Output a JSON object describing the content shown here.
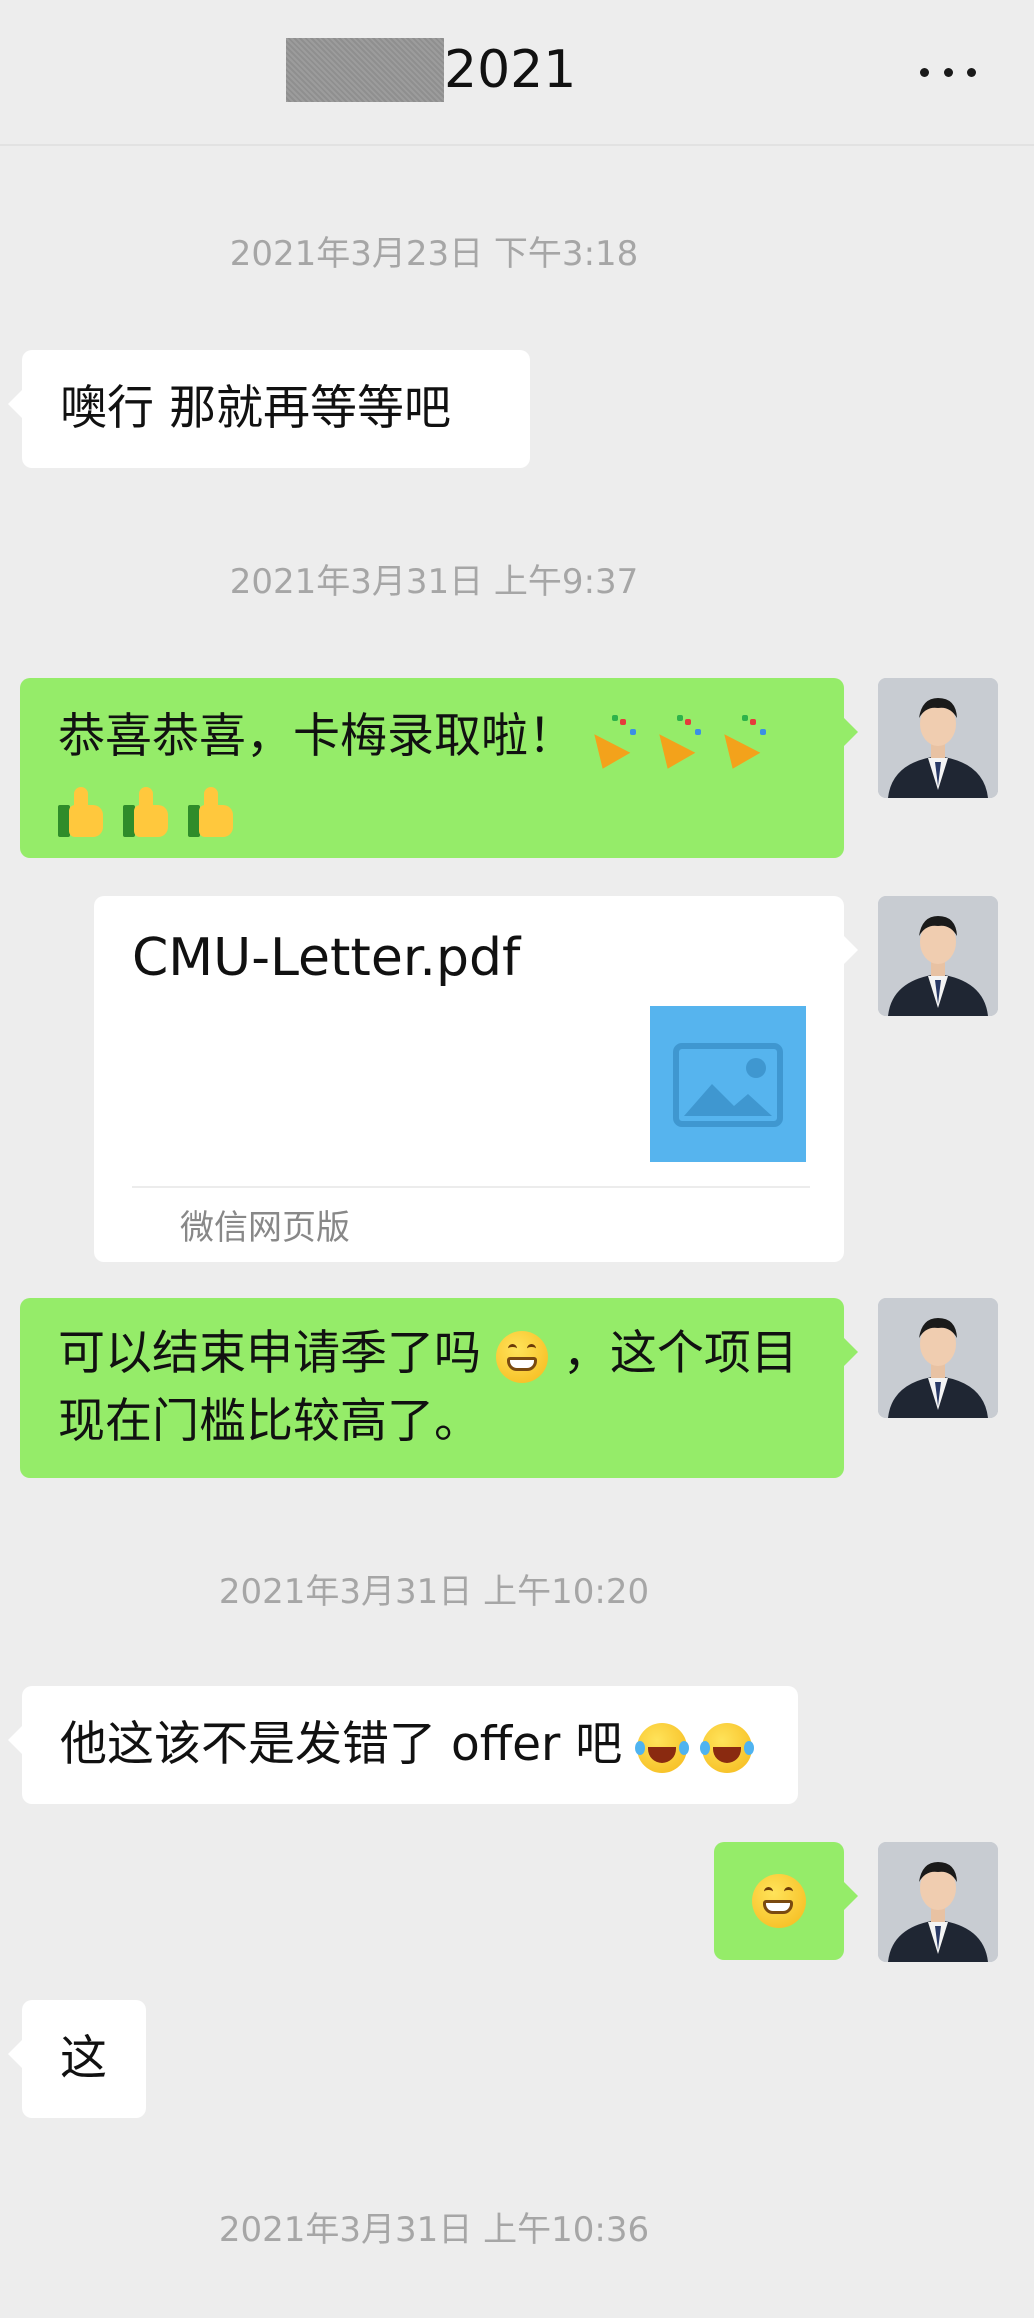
{
  "header": {
    "title": "2021",
    "more_icon": "more-dots-icon"
  },
  "messages": {
    "ts1": "2021年3月23日 下午3:18",
    "m1": "噢行  那就再等等吧",
    "ts2": "2021年3月31日 上午9:37",
    "m2_text": "恭喜恭喜，卡梅录取啦！",
    "m2_emoji_line1": [
      "party-popper",
      "party-popper",
      "party-popper"
    ],
    "m2_emoji_line2": [
      "thumbs-up",
      "thumbs-up",
      "thumbs-up"
    ],
    "card": {
      "filename": "CMU-Letter.pdf",
      "source": "微信网页版",
      "thumbnail_icon": "image-placeholder-icon"
    },
    "m3_line1": "可以结束申请季了吗",
    "m3_line1_tail": "，这个项目",
    "m3_line2": "现在门槛比较高了。",
    "ts3": "2021年3月31日 上午10:20",
    "m4": "他这该不是发错了 offer 吧",
    "m4_emoji": [
      "tears-of-joy",
      "tears-of-joy"
    ],
    "m5_emoji": "grinning-face",
    "m6": "这",
    "ts4": "2021年3月31日 上午10:36"
  },
  "colors": {
    "background": "#ededed",
    "bubble_self": "#95ec69",
    "bubble_other": "#ffffff",
    "timestamp": "#a6a6a6",
    "thumbnail": "#56b4ee"
  }
}
